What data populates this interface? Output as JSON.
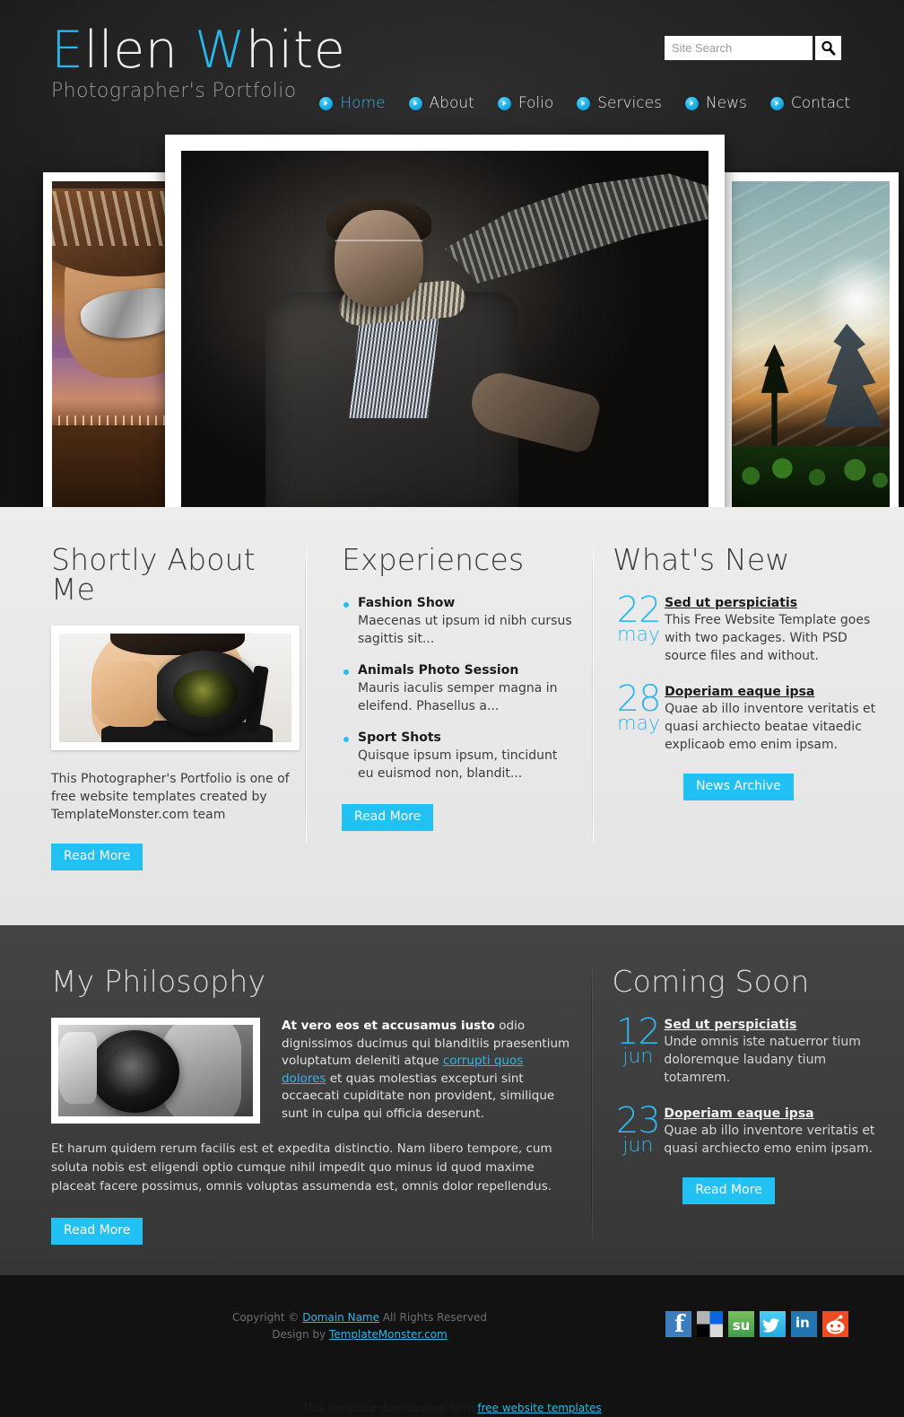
{
  "header": {
    "logo_first": "E",
    "logo_rest1": "llen ",
    "logo_second": "W",
    "logo_rest2": "hite",
    "tagline": "Photographer's Portfolio",
    "search_placeholder": "Site Search",
    "search_value": "",
    "search_icon": "search-icon",
    "nav": [
      {
        "label": "Home",
        "active": true
      },
      {
        "label": "About",
        "active": false
      },
      {
        "label": "Folio",
        "active": false
      },
      {
        "label": "Services",
        "active": false
      },
      {
        "label": "News",
        "active": false
      },
      {
        "label": "Contact",
        "active": false
      }
    ]
  },
  "slider": {
    "slides": [
      {
        "name": "cowboy-sunglasses-photo"
      },
      {
        "name": "male-model-portrait-photo"
      },
      {
        "name": "sunset-landscape-photo"
      }
    ]
  },
  "about": {
    "title": "Shortly About Me",
    "image_name": "photographer-with-camera-photo",
    "text": "This Photographer's Portfolio is one of free website templates created by TemplateMonster.com team",
    "button": "Read More"
  },
  "experiences": {
    "title": "Experiences",
    "items": [
      {
        "name": "Fashion Show",
        "desc": "Maecenas ut ipsum id nibh cursus sagittis sit..."
      },
      {
        "name": "Animals Photo Session",
        "desc": "Mauris iaculis semper magna in eleifend. Phasellus a..."
      },
      {
        "name": "Sport Shots",
        "desc": "Quisque ipsum ipsum, tincidunt eu euismod non, blandit..."
      }
    ],
    "button": "Read More"
  },
  "whats_new": {
    "title": "What's New",
    "items": [
      {
        "day": "22",
        "month": "may",
        "title": "Sed ut perspiciatis",
        "desc": "This Free Website Template goes with two packages. With PSD source files and without."
      },
      {
        "day": "28",
        "month": "may",
        "title": "Doperiam eaque ipsa",
        "desc": "Quae ab illo inventore veritatis et quasi archiecto beatae vitaedic explicaob emo enim ipsam."
      }
    ],
    "button": "News Archive"
  },
  "philosophy": {
    "title": "My Philosophy",
    "image_name": "bw-camera-closeup-photo",
    "lead_bold": "At vero eos et accusamus iusto",
    "lead_part1": " odio dignissimos ducimus qui blanditiis praesentium voluptatum deleniti atque ",
    "lead_link": "corrupti quos dolores",
    "lead_part2": " et quas molestias excepturi sint occaecati cupiditate non provident, similique sunt in culpa qui officia deserunt.",
    "paragraph": "Et harum quidem rerum facilis est et expedita distinctio. Nam libero tempore, cum soluta nobis est eligendi optio cumque nihil impedit quo minus id quod maxime placeat facere possimus, omnis voluptas assumenda est, omnis dolor repellendus.",
    "button": "Read More"
  },
  "coming_soon": {
    "title": "Coming Soon",
    "items": [
      {
        "day": "12",
        "month": "jun",
        "title": "Sed ut perspiciatis",
        "desc": "Unde omnis iste natuerror tium doloremque laudany tium totamrem."
      },
      {
        "day": "23",
        "month": "jun",
        "title": "Doperiam eaque ipsa",
        "desc": "Quae ab illo inventore veritatis et quasi archiecto emo enim ipsam."
      }
    ],
    "button": "Read More"
  },
  "footer": {
    "copyright_pre": "Copyright © ",
    "copyright_link": "Domain Name",
    "copyright_post": " All Rights Reserved",
    "design_pre": "Design by ",
    "design_link": "TemplateMonster.com",
    "socials": [
      {
        "name": "facebook-icon"
      },
      {
        "name": "delicious-icon"
      },
      {
        "name": "stumbleupon-icon"
      },
      {
        "name": "twitter-icon"
      },
      {
        "name": "linkedin-icon"
      },
      {
        "name": "reddit-icon"
      }
    ],
    "bottom_pre": "This template downloaded form ",
    "bottom_link": "free website templates"
  },
  "colors": {
    "accent": "#21c1f3",
    "accent_text": "#2fb6ea",
    "dark_bg": "#3d3d3d",
    "light_bg": "#e9e9e9",
    "footer_bg": "#121212"
  }
}
